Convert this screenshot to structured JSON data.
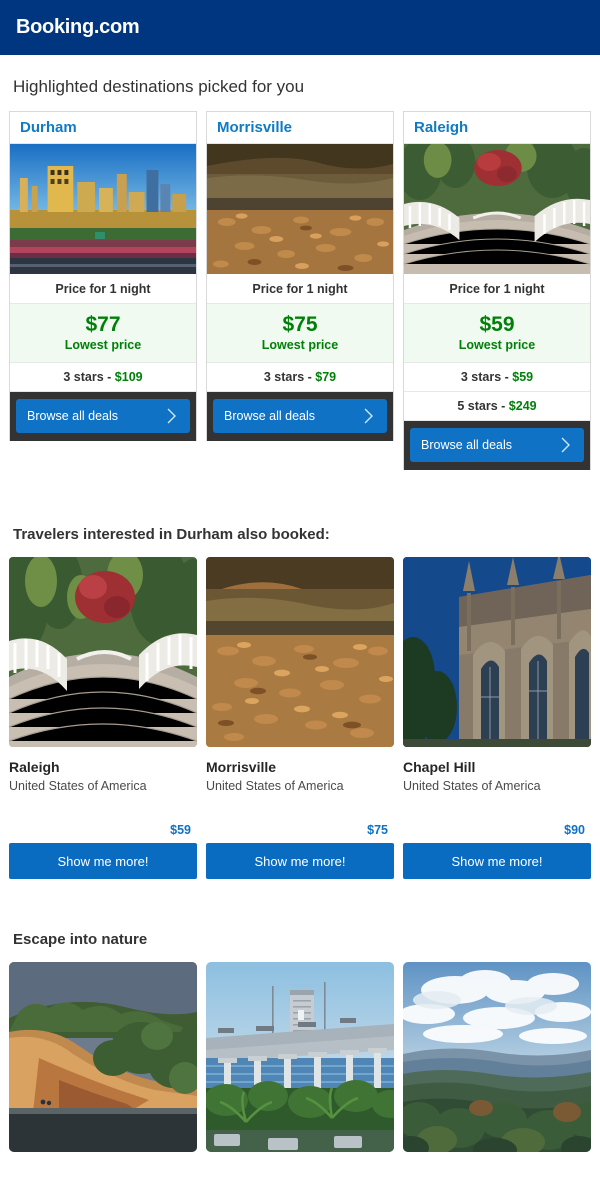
{
  "header": {
    "logo": "Booking.com",
    "bg": "#003580"
  },
  "sections": {
    "highlighted": {
      "title": "Highlighted destinations picked for you"
    },
    "also_booked": {
      "title": "Travelers interested in Durham also booked:"
    },
    "nature": {
      "title": "Escape into nature"
    }
  },
  "deal_cards": [
    {
      "city": "Durham",
      "photo_alt": "durham-skyline-dusk-photo",
      "price_caption": "Price for 1 night",
      "price": "$77",
      "price_label": "Lowest price",
      "star_rows": [
        {
          "stars": "3 stars - ",
          "amount": "$109"
        }
      ],
      "button": "Browse all deals",
      "button_icon": "chevron-right-icon"
    },
    {
      "city": "Morrisville",
      "photo_alt": "morrisville-autumn-creek-photo",
      "price_caption": "Price for 1 night",
      "price": "$75",
      "price_label": "Lowest price",
      "star_rows": [
        {
          "stars": "3 stars - ",
          "amount": "$79"
        }
      ],
      "button": "Browse all deals",
      "button_icon": "chevron-right-icon"
    },
    {
      "city": "Raleigh",
      "photo_alt": "raleigh-white-footbridge-photo",
      "price_caption": "Price for 1 night",
      "price": "$59",
      "price_label": "Lowest price",
      "star_rows": [
        {
          "stars": "3 stars - ",
          "amount": "$59"
        },
        {
          "stars": "5 stars - ",
          "amount": "$249"
        }
      ],
      "button": "Browse all deals",
      "button_icon": "chevron-right-icon"
    }
  ],
  "also_booked": [
    {
      "name": "Raleigh",
      "country": "United States of America",
      "price": "$59",
      "button": "Show me more!",
      "photo_alt": "raleigh-white-footbridge-photo"
    },
    {
      "name": "Morrisville",
      "country": "United States of America",
      "price": "$75",
      "button": "Show me more!",
      "photo_alt": "morrisville-autumn-leaves-photo"
    },
    {
      "name": "Chapel Hill",
      "country": "United States of America",
      "price": "$90",
      "button": "Show me more!",
      "photo_alt": "chapel-hill-gothic-chapel-photo"
    }
  ],
  "nature": [
    {
      "photo_alt": "sand-bluff-over-lake-photo"
    },
    {
      "photo_alt": "bridge-over-water-palms-photo"
    },
    {
      "photo_alt": "forested-hills-clouds-photo"
    }
  ],
  "colors": {
    "brand_blue": "#003580",
    "link_blue": "#0f7bc4",
    "button_blue": "#0f72c4",
    "price_green": "#008009",
    "price_bg": "#f1faf1",
    "button_band": "#333333"
  }
}
